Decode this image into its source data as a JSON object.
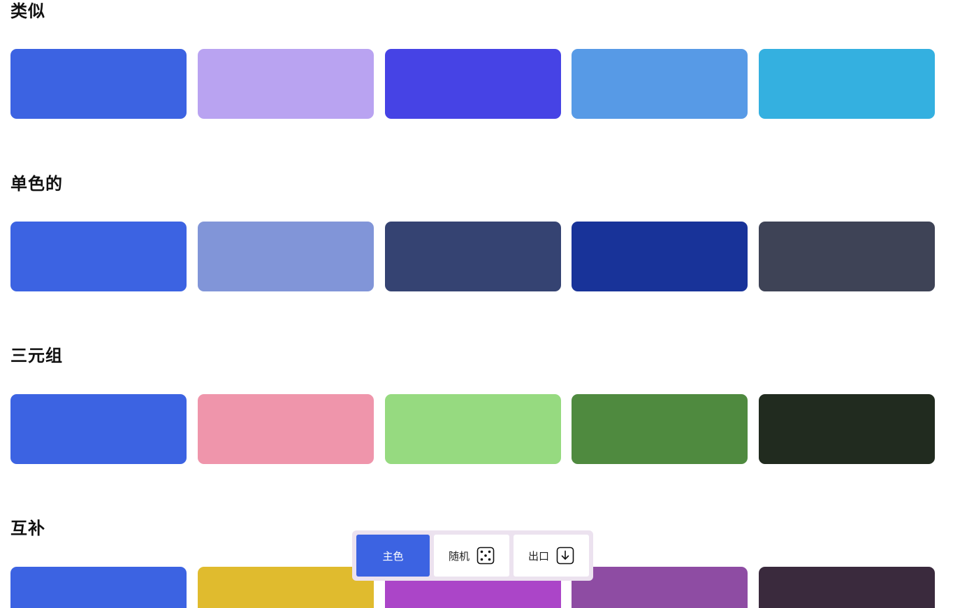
{
  "sections": [
    {
      "title": "类似",
      "colors": [
        "#3c63e2",
        "#b9a3f1",
        "#4643e5",
        "#579ae6",
        "#34b0e0"
      ]
    },
    {
      "title": "单色的",
      "colors": [
        "#3c63e2",
        "#8195d8",
        "#354372",
        "#183399",
        "#3e4356"
      ]
    },
    {
      "title": "三元组",
      "colors": [
        "#3c63e2",
        "#ef95ab",
        "#96da80",
        "#4f8a3f",
        "#212b1f"
      ]
    },
    {
      "title": "互补",
      "colors": [
        "#3c63e2",
        "#e0bb2e",
        "#ab45c8",
        "#8e4ca3",
        "#3a2a3d"
      ]
    }
  ],
  "toolbar": {
    "primary_label": "主色",
    "random_label": "随机",
    "export_label": "出口",
    "primary_color": "#3c63e2",
    "random_icon": "dice-five-icon",
    "export_icon": "download-arrow-icon"
  }
}
